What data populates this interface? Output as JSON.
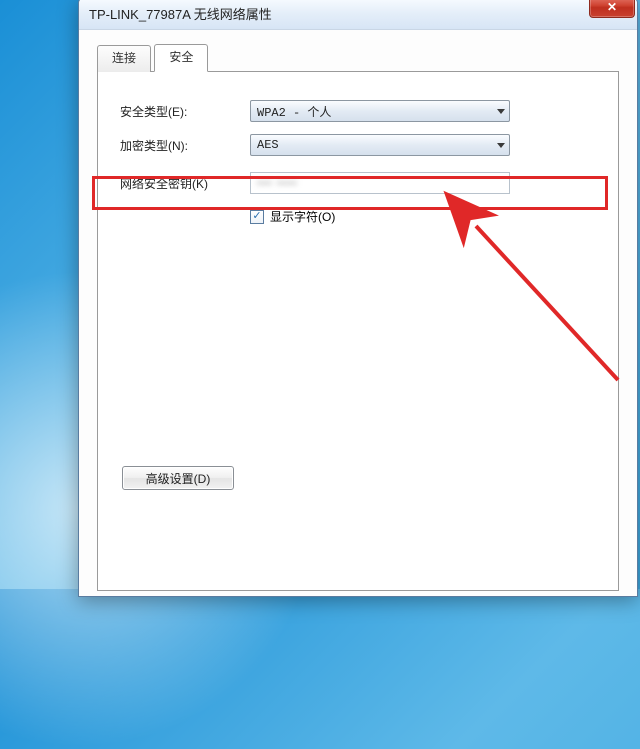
{
  "window": {
    "title": "TP-LINK_77987A 无线网络属性",
    "close_glyph": "✕"
  },
  "tabs": {
    "connect": "连接",
    "security": "安全"
  },
  "security": {
    "type_label": "安全类型(E):",
    "type_value": "WPA2 - 个人",
    "cipher_label": "加密类型(N):",
    "cipher_value": "AES",
    "key_label": "网络安全密钥(K)",
    "key_value_masked": "••• ••••",
    "show_chars_label": "显示字符(O)"
  },
  "advanced_button": "高级设置(D)"
}
